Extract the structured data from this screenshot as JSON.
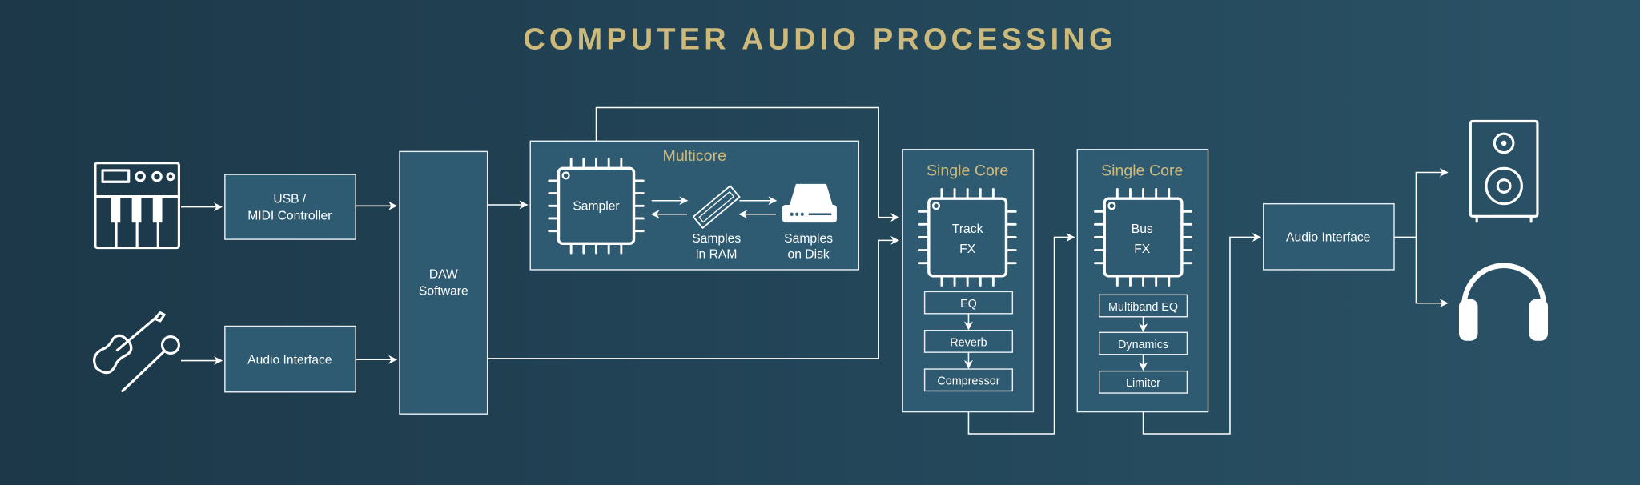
{
  "title": "COMPUTER AUDIO PROCESSING",
  "colors": {
    "title": "#cdb97a",
    "box_fill": "#2e5b72",
    "background": "#1f3e50",
    "line": "#ffffff"
  },
  "inputs": {
    "keyboard_icon": "midi-keyboard-icon",
    "instruments_icon": "guitar-microphone-icon",
    "usb_midi": {
      "line1": "USB /",
      "line2": "MIDI Controller"
    },
    "audio_interface_in": "Audio Interface"
  },
  "daw": {
    "line1": "DAW",
    "line2": "Software"
  },
  "multicore": {
    "label": "Multicore",
    "chip": "Sampler",
    "ram": {
      "line1": "Samples",
      "line2": "in RAM"
    },
    "disk": {
      "line1": "Samples",
      "line2": "on Disk"
    }
  },
  "track_core": {
    "label": "Single Core",
    "chip_line1": "Track",
    "chip_line2": "FX",
    "chain": [
      "EQ",
      "Reverb",
      "Compressor"
    ]
  },
  "bus_core": {
    "label": "Single Core",
    "chip_line1": "Bus",
    "chip_line2": "FX",
    "chain": [
      "Multiband EQ",
      "Dynamics",
      "Limiter"
    ]
  },
  "output": {
    "audio_interface_out": "Audio Interface",
    "speaker_icon": "speaker-icon",
    "headphones_icon": "headphones-icon"
  }
}
